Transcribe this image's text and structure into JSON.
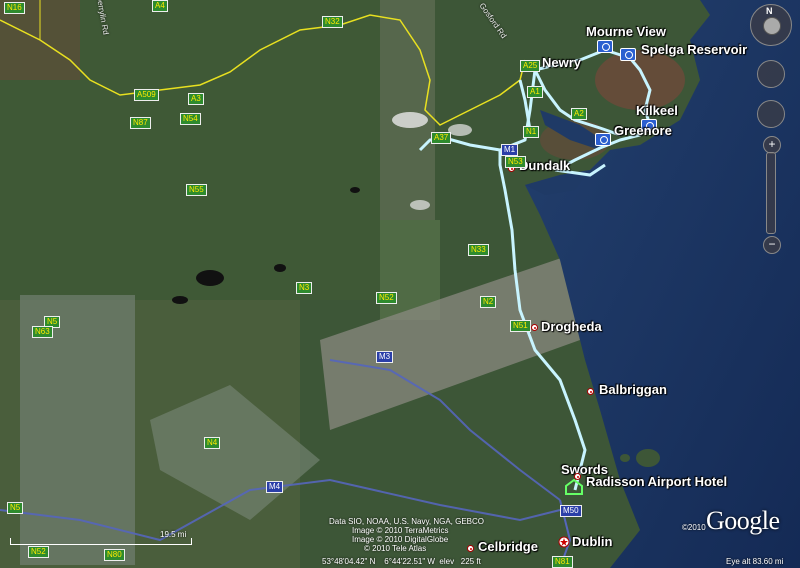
{
  "places": {
    "mourne_view": "Mourne View",
    "spelga": "Spelga Reservoir",
    "newry": "Newry",
    "kilkeel": "Kilkeel",
    "greenore": "Greenore",
    "dundalk": "Dundalk",
    "drogheda": "Drogheda",
    "balbriggan": "Balbriggan",
    "swords": "Swords",
    "radisson": "Radisson Airport Hotel",
    "dublin": "Dublin",
    "celbridge": "Celbridge"
  },
  "roads": {
    "n16": "N16",
    "a4": "A4",
    "n32": "N32",
    "gosford": "Gosford Rd",
    "derrylin": "Derrylin Rd",
    "a509": "A509",
    "a3": "A3",
    "n54": "N54",
    "n87": "N87",
    "a25": "A25",
    "a1": "A1",
    "a2": "A2",
    "a37": "A37",
    "m1": "M1",
    "n1": "N1",
    "n53": "N53",
    "n55": "N55",
    "n33": "N33",
    "n2": "N2",
    "n52": "N52",
    "n3": "N3",
    "n51": "N51",
    "n5a": "N5",
    "n63": "N63",
    "m3": "M3",
    "n4": "N4",
    "m4": "M4",
    "n5b": "N5",
    "m50": "M50",
    "n80": "N80",
    "n81": "N81",
    "n52b": "N52"
  },
  "attribution": {
    "line1": "Data SIO, NOAA, U.S. Navy, NGA, GEBCO",
    "line2": "Image © 2010 TerraMetrics",
    "line3": "Image © 2010 DigitalGlobe",
    "line4": "© 2010 Tele Atlas",
    "copyright": "©2010"
  },
  "status": {
    "coords": "53°48'04.42\" N    6°44'22.51\" W  elev   225 ft",
    "eye_alt": "Eye alt    83.60 mi",
    "scale": "19.5 mi"
  },
  "logo": "Google",
  "nav": {
    "north": "N"
  },
  "colors": {
    "route": "#c8f4ff",
    "border": "#e8e020",
    "land": "#3d5a3a",
    "sea": "#1c3a6a"
  }
}
